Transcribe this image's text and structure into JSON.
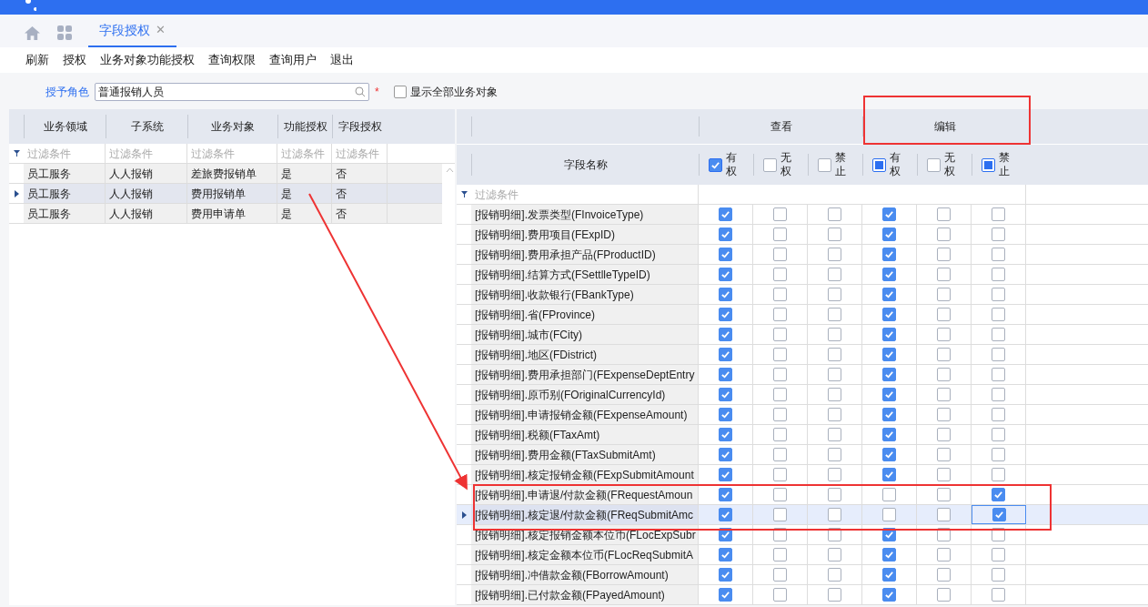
{
  "tabs": [
    {
      "label": "字段授权",
      "selected": true,
      "close": "✕"
    }
  ],
  "toolbar": [
    "刷新",
    "授权",
    "业务对象功能授权",
    "查询权限",
    "查询用户",
    "退出"
  ],
  "role": {
    "label": "授予角色",
    "value": "普通报销人员",
    "required": "*"
  },
  "show_all": {
    "label": "显示全部业务对象",
    "checked": false
  },
  "left_table": {
    "columns": [
      "业务领域",
      "子系统",
      "业务对象",
      "功能授权",
      "字段授权"
    ],
    "filter": [
      "过滤条件",
      "过滤条件",
      "过滤条件",
      "过滤条件",
      "过滤条件"
    ],
    "rows": [
      {
        "cells": [
          "员工服务",
          "人人报销",
          "差旅费报销单",
          "是",
          "否"
        ],
        "selected": false
      },
      {
        "cells": [
          "员工服务",
          "人人报销",
          "费用报销单",
          "是",
          "否"
        ],
        "selected": true
      },
      {
        "cells": [
          "员工服务",
          "人人报销",
          "费用申请单",
          "是",
          "否"
        ],
        "selected": false
      }
    ]
  },
  "right_table": {
    "groups": [
      "查看",
      "编辑"
    ],
    "name_column": "字段名称",
    "filter": "过滤条件",
    "check_columns": [
      {
        "label": "有权",
        "checked": true,
        "partial": false
      },
      {
        "label": "无权",
        "checked": false,
        "partial": false
      },
      {
        "label": "禁止",
        "checked": false,
        "partial": false
      },
      {
        "label": "有权",
        "checked": true,
        "partial": true
      },
      {
        "label": "无权",
        "checked": false,
        "partial": false
      },
      {
        "label": "禁止",
        "checked": true,
        "partial": true
      }
    ],
    "rows": [
      {
        "name": "[报销明细].发票类型(FInvoiceType)",
        "checks": [
          true,
          false,
          false,
          true,
          false,
          false
        ],
        "selected": false
      },
      {
        "name": "[报销明细].费用项目(FExpID)",
        "checks": [
          true,
          false,
          false,
          true,
          false,
          false
        ],
        "selected": false
      },
      {
        "name": "[报销明细].费用承担产品(FProductID)",
        "checks": [
          true,
          false,
          false,
          true,
          false,
          false
        ],
        "selected": false
      },
      {
        "name": "[报销明细].结算方式(FSettlleTypeID)",
        "checks": [
          true,
          false,
          false,
          true,
          false,
          false
        ],
        "selected": false
      },
      {
        "name": "[报销明细].收款银行(FBankType)",
        "checks": [
          true,
          false,
          false,
          true,
          false,
          false
        ],
        "selected": false
      },
      {
        "name": "[报销明细].省(FProvince)",
        "checks": [
          true,
          false,
          false,
          true,
          false,
          false
        ],
        "selected": false
      },
      {
        "name": "[报销明细].城市(FCity)",
        "checks": [
          true,
          false,
          false,
          true,
          false,
          false
        ],
        "selected": false
      },
      {
        "name": "[报销明细].地区(FDistrict)",
        "checks": [
          true,
          false,
          false,
          true,
          false,
          false
        ],
        "selected": false
      },
      {
        "name": "[报销明细].费用承担部门(FExpenseDeptEntry",
        "checks": [
          true,
          false,
          false,
          true,
          false,
          false
        ],
        "selected": false
      },
      {
        "name": "[报销明细].原币别(FOriginalCurrencyId)",
        "checks": [
          true,
          false,
          false,
          true,
          false,
          false
        ],
        "selected": false
      },
      {
        "name": "[报销明细].申请报销金额(FExpenseAmount)",
        "checks": [
          true,
          false,
          false,
          true,
          false,
          false
        ],
        "selected": false
      },
      {
        "name": "[报销明细].税额(FTaxAmt)",
        "checks": [
          true,
          false,
          false,
          true,
          false,
          false
        ],
        "selected": false
      },
      {
        "name": "[报销明细].费用金额(FTaxSubmitAmt)",
        "checks": [
          true,
          false,
          false,
          true,
          false,
          false
        ],
        "selected": false
      },
      {
        "name": "[报销明细].核定报销金额(FExpSubmitAmount",
        "checks": [
          true,
          false,
          false,
          true,
          false,
          false
        ],
        "selected": false
      },
      {
        "name": "[报销明细].申请退/付款金额(FRequestAmoun",
        "checks": [
          true,
          false,
          false,
          false,
          false,
          true
        ],
        "selected": false
      },
      {
        "name": "[报销明细].核定退/付款金额(FReqSubmitAmc",
        "checks": [
          true,
          false,
          false,
          false,
          false,
          true
        ],
        "selected": true
      },
      {
        "name": "[报销明细].核定报销金额本位币(FLocExpSubr",
        "checks": [
          true,
          false,
          false,
          true,
          false,
          false
        ],
        "selected": false
      },
      {
        "name": "[报销明细].核定金额本位币(FLocReqSubmitA",
        "checks": [
          true,
          false,
          false,
          true,
          false,
          false
        ],
        "selected": false
      },
      {
        "name": "[报销明细].冲借款金额(FBorrowAmount)",
        "checks": [
          true,
          false,
          false,
          true,
          false,
          false
        ],
        "selected": false
      },
      {
        "name": "[报销明细].已付款金额(FPayedAmount)",
        "checks": [
          true,
          false,
          false,
          true,
          false,
          false
        ],
        "selected": false
      }
    ]
  }
}
